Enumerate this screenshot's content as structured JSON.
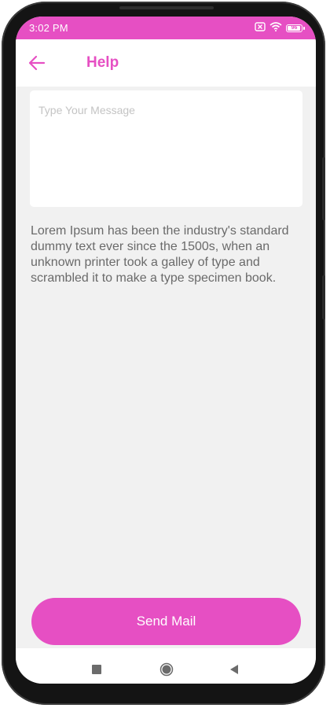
{
  "status_bar": {
    "time": "3:02 PM",
    "battery_level": "96",
    "icons": [
      "sim-x-icon",
      "wifi-icon",
      "battery-icon"
    ]
  },
  "header": {
    "back_icon": "arrow-left-icon",
    "title": "Help"
  },
  "message": {
    "placeholder": "Type Your Message",
    "value": ""
  },
  "info_text": "Lorem Ipsum has been the industry's standard dummy text ever since the 1500s, when an unknown printer took a galley of type and scrambled it to make a type specimen book.",
  "send_button": {
    "label": "Send Mail"
  },
  "nav_bar": {
    "icons": [
      "square-recents-icon",
      "circle-home-icon",
      "triangle-back-icon"
    ]
  },
  "colors": {
    "accent": "#e64fc3",
    "background": "#f1f1f1",
    "text_secondary": "#6a6a6a"
  }
}
